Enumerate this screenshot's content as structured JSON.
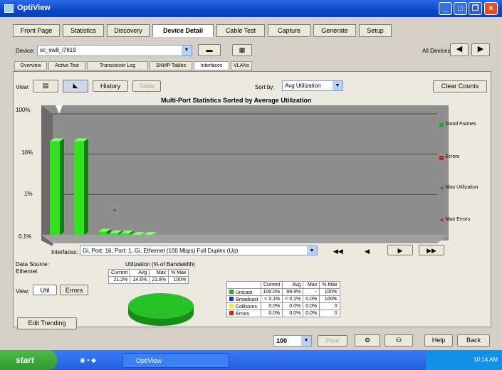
{
  "window": {
    "title": "OptiView"
  },
  "main_tabs": [
    "Front Page",
    "Statistics",
    "Discovery",
    "Device Detail",
    "Cable Test",
    "Capture",
    "Generate",
    "Setup"
  ],
  "device": {
    "label": "Device:",
    "value": "sc_sw8_i7619",
    "all_devices_label": "All Devices:"
  },
  "sub_tabs": [
    "Overview",
    "Active Test",
    "Transceiver Log",
    "SNMP Tables",
    "Interfaces",
    "VLANs"
  ],
  "toolbar": {
    "view_label": "View:",
    "history_label": "History",
    "table_label": "Table",
    "sort_label": "Sort by:",
    "sort_value": "Avg Utilization",
    "clear_counts": "Clear Counts"
  },
  "chart_data": {
    "type": "bar",
    "title": "Multi-Port Statistics Sorted by Average Utilization",
    "y_scale": "log",
    "y_ticks": [
      "100%",
      "10%",
      "1%",
      "0.1%"
    ],
    "values": [
      21,
      21,
      0.12,
      0.11,
      0.11,
      0.1,
      0.1
    ],
    "legend": [
      {
        "name": "Good Frames",
        "color": "#22aa22"
      },
      {
        "name": "Errors",
        "color": "#cc2222"
      },
      {
        "name": "Max Utilization",
        "color": "#2a8a2a"
      },
      {
        "name": "Max Errors",
        "color": "#cc2222"
      }
    ]
  },
  "interface": {
    "label": "Interfaces:",
    "value": "Gi, Port: 16, Port: 1, Gi, Ethernet (100 Mbps) Full Duplex (Up)"
  },
  "data_source": {
    "label": "Data Source:",
    "value": "Ethernet",
    "view_label": "View:",
    "util_btn": "Util",
    "errors_btn": "Errors"
  },
  "utilization": {
    "heading": "Utilization (% of Bandwidth)",
    "headers": [
      "Current",
      "Avg",
      "Max",
      "% Max"
    ],
    "values": [
      "21.2%",
      "14.6%",
      "21.9%",
      "100%"
    ]
  },
  "stats_table": {
    "headers": [
      "",
      "Current",
      "Avg",
      "Max",
      "% Max"
    ],
    "rows": [
      {
        "name": "Unicast",
        "color": "#22aa22",
        "vals": [
          "100.0%",
          "99.9%",
          "-",
          "100%"
        ]
      },
      {
        "name": "Broadcast",
        "color": "#2233cc",
        "vals": [
          "< 0.1%",
          "< 0.1%",
          "0.0%",
          "100%"
        ]
      },
      {
        "name": "Collisions",
        "color": "#eeee22",
        "vals": [
          "0.0%",
          "0.0%",
          "0.0%",
          "0"
        ]
      },
      {
        "name": "Errors",
        "color": "#cc2222",
        "vals": [
          "0.0%",
          "0.0%",
          "0.0%",
          "0"
        ]
      }
    ]
  },
  "edit_trending": "Edit Trending",
  "bottom": {
    "zoom": "100",
    "print": "Print",
    "help": "Help",
    "back": "Back"
  },
  "taskbar": {
    "start": "start",
    "app": "OptiView",
    "time": "10:14 AM"
  }
}
